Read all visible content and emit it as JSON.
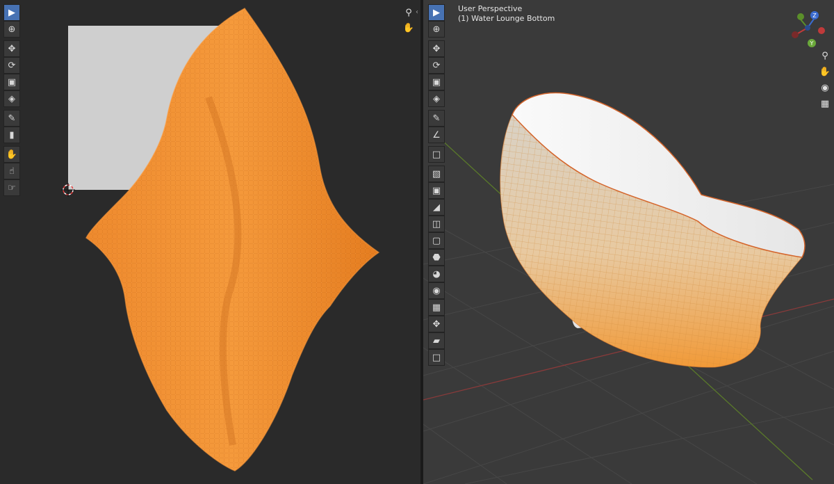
{
  "uv_editor": {
    "tools": [
      "select-box-icon",
      "cursor-icon",
      "move-icon",
      "rotate-icon",
      "scale-icon",
      "transform-icon",
      "annotate-icon",
      "rip-icon",
      "grab-icon",
      "relax-icon",
      "pinch-icon"
    ],
    "nav": [
      "zoom-icon",
      "pan-hand-icon"
    ]
  },
  "viewport": {
    "perspective_label": "User Perspective",
    "object_label": "(1) Water Lounge Bottom",
    "tools": [
      "select-box-icon",
      "cursor-icon",
      "move-icon",
      "rotate-icon",
      "scale-icon",
      "transform-icon",
      "annotate-icon",
      "measure-icon",
      "add-cube-icon",
      "extrude-icon",
      "inset-icon",
      "bevel-icon",
      "loop-cut-icon",
      "knife-icon",
      "poly-build-icon",
      "spin-icon",
      "smooth-icon",
      "edge-slide-icon",
      "shrink-fatten-icon",
      "shear-icon",
      "rip-region-icon"
    ],
    "nav": [
      "zoom-icon",
      "pan-hand-icon",
      "camera-icon",
      "grid-icon"
    ],
    "gizmo_axes": [
      "X",
      "Y",
      "Z"
    ]
  },
  "colors": {
    "selection": "#f08a24",
    "active_tool": "#4772b3",
    "background": "#3a3a3a"
  }
}
